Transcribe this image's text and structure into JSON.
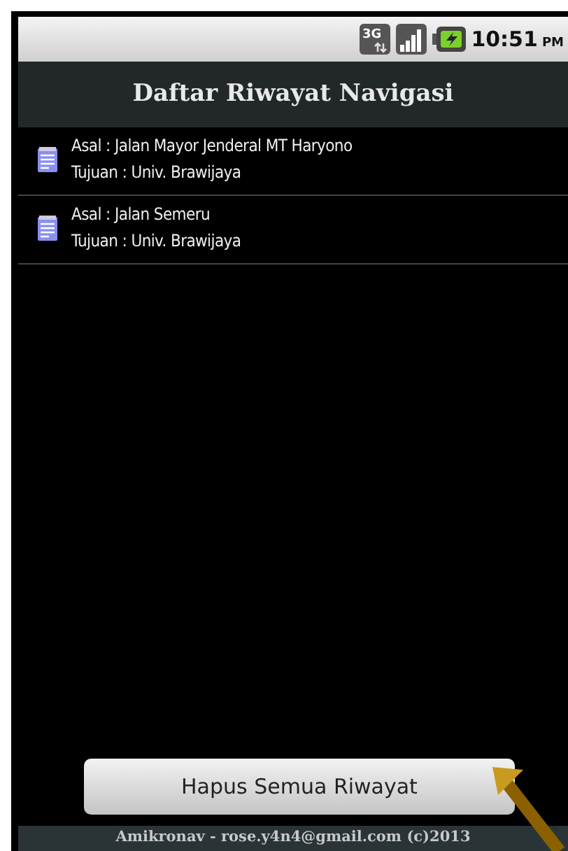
{
  "status_bar": {
    "time": "10:51",
    "period": "PM",
    "network": "3G"
  },
  "title": "Daftar Riwayat Navigasi",
  "history": [
    {
      "origin": "Asal : Jalan Mayor Jenderal MT Haryono",
      "destination": "Tujuan : Univ. Brawijaya"
    },
    {
      "origin": "Asal : Jalan Semeru",
      "destination": "Tujuan : Univ. Brawijaya"
    }
  ],
  "button": "Hapus Semua Riwayat",
  "footer": "Amikronav - rose.y4n4@gmail.com (c)2013"
}
